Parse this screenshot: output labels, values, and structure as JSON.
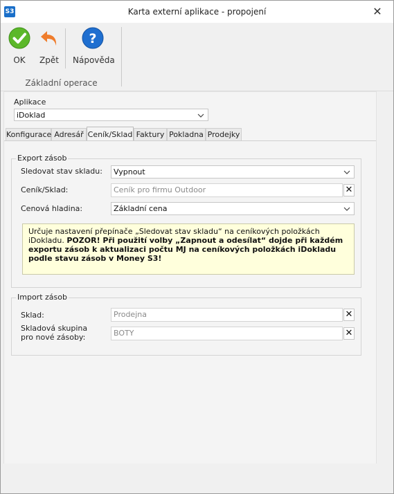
{
  "window": {
    "title": "Karta externí aplikace - propojení",
    "app_badge": "S3",
    "close_glyph": "✕"
  },
  "ribbon": {
    "ok_label": "OK",
    "back_label": "Zpět",
    "help_label": "Nápověda",
    "group_label": "Základní operace",
    "icons": {
      "ok": "check-circle-icon",
      "back": "undo-arrow-icon",
      "help": "question-circle-icon"
    },
    "colors": {
      "ok": "#5cb82a",
      "back": "#ef7d2c",
      "help": "#1f6fd0"
    }
  },
  "aplikace": {
    "label": "Aplikace",
    "value": "iDoklad"
  },
  "tabs": [
    {
      "label": "Konfigurace",
      "active": false
    },
    {
      "label": "Adresář",
      "active": false
    },
    {
      "label": "Ceník/Sklad",
      "active": true
    },
    {
      "label": "Faktury",
      "active": false
    },
    {
      "label": "Pokladna",
      "active": false
    },
    {
      "label": "Prodejky",
      "active": false
    }
  ],
  "export": {
    "title": "Export zásob",
    "sledovat_label": "Sledovat stav skladu:",
    "sledovat_value": "Vypnout",
    "cenik_label": "Ceník/Sklad:",
    "cenik_value": "Ceník pro firmu Outdoor",
    "hladina_label": "Cenová hladina:",
    "hladina_value": "Základní cena",
    "note_plain": "Určuje nastavení přepínače „Sledovat stav skladu“ na ceníkových položkách iDokladu. ",
    "note_bold": "POZOR! Při použití volby „Zapnout a odesílat“ dojde při každém exportu zásob k aktualizaci počtu MJ na ceníkových položkách iDokladu podle stavu zásob v Money S3!"
  },
  "import": {
    "title": "Import zásob",
    "sklad_label": "Sklad:",
    "sklad_value": "Prodejna",
    "skupina_label_1": "Skladová skupina",
    "skupina_label_2": "pro nové zásoby:",
    "skupina_value": "BOTY"
  },
  "clear_glyph": "✕"
}
